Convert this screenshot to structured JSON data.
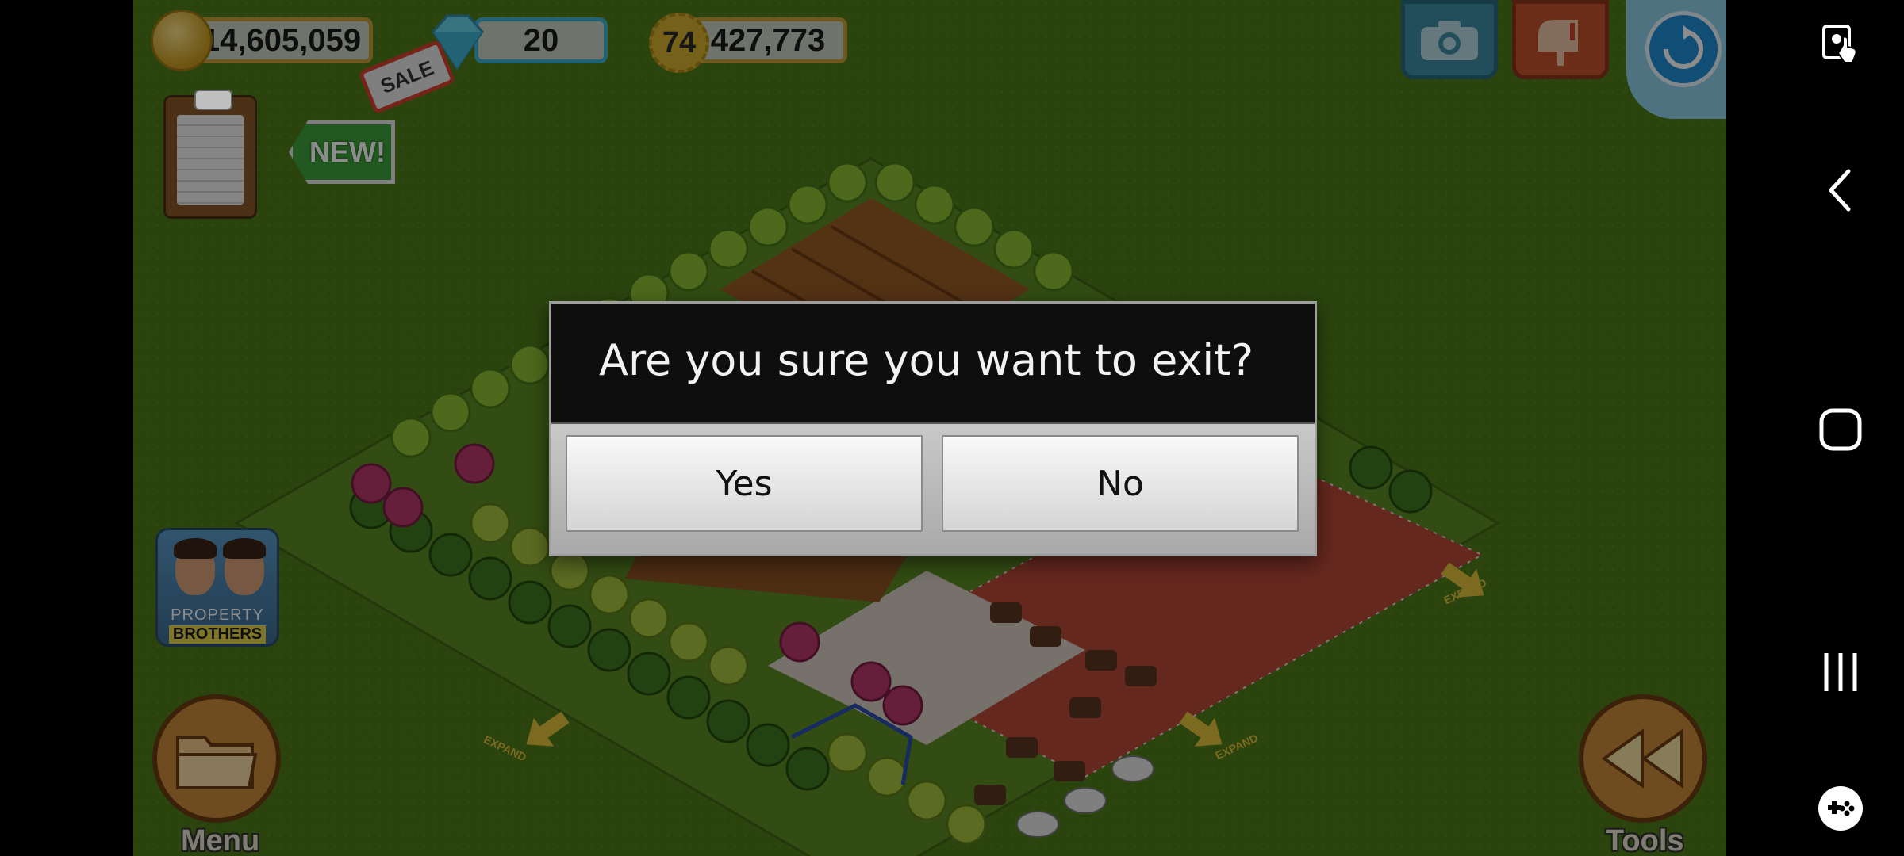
{
  "hud": {
    "coins": "14,605,059",
    "gems": "20",
    "level": "74",
    "xp": "427,773",
    "sale_label": "SALE",
    "new_label": "NEW!"
  },
  "promo": {
    "line1": "PROPERTY",
    "line2": "BROTHERS"
  },
  "bottom": {
    "menu_label": "Menu",
    "tools_label": "Tools"
  },
  "farm": {
    "expand_label": "EXPAND"
  },
  "dialog": {
    "title": "Are you sure you want to exit?",
    "yes_label": "Yes",
    "no_label": "No"
  },
  "colors": {
    "grass": "#4f7c1b",
    "dialog_header": "#0e0e0e",
    "coin_pill_border": "#c7a13a",
    "gem_pill_border": "#3fb3d6"
  },
  "icons": {
    "system_bar": [
      "screen-touch-icon",
      "back-icon",
      "home-icon",
      "recents-icon",
      "game-tools-icon"
    ],
    "top_right": [
      "camera-icon",
      "mailbox-icon",
      "sync-icon"
    ]
  }
}
